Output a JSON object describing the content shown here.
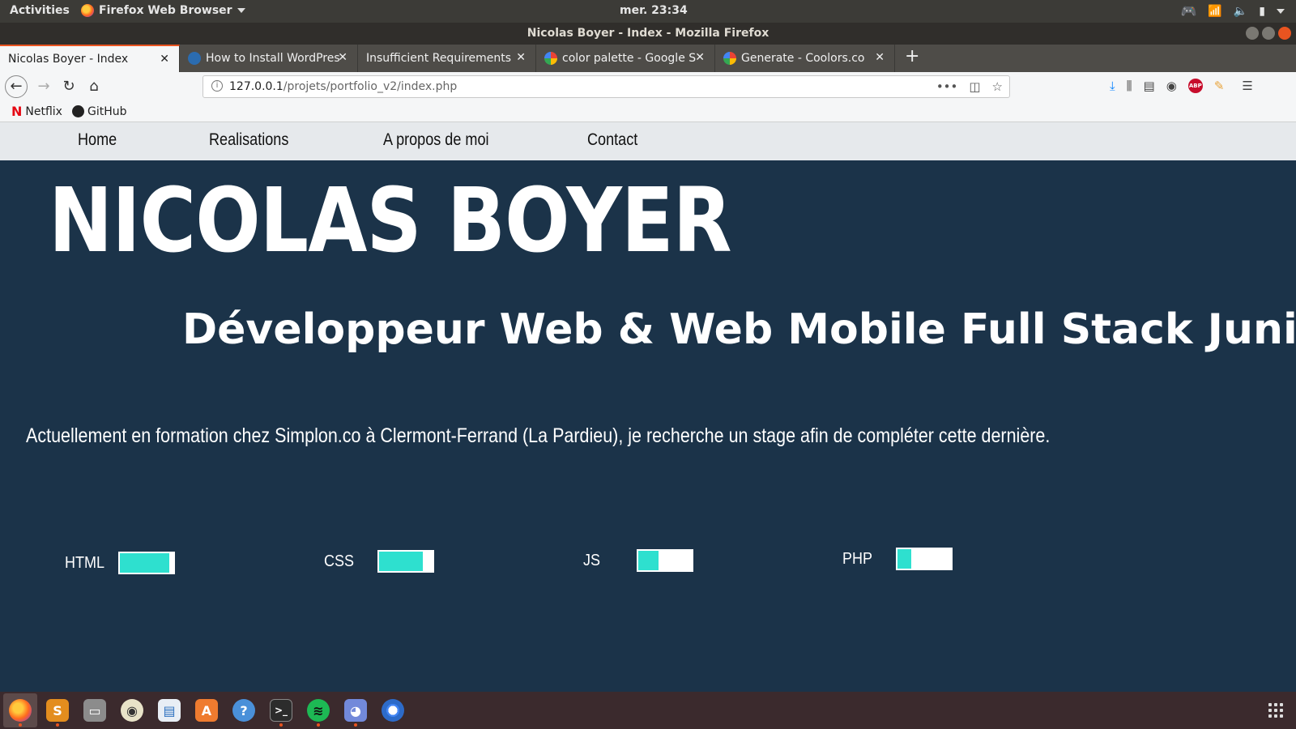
{
  "system_bar": {
    "activities": "Activities",
    "app_menu": "Firefox Web Browser",
    "clock": "mer. 23:34"
  },
  "window": {
    "title": "Nicolas Boyer - Index - Mozilla Firefox"
  },
  "tabs": [
    {
      "label": "Nicolas Boyer - Index",
      "active": true,
      "favicon_color": "#f5f6f7"
    },
    {
      "label": "How to Install WordPress",
      "active": false,
      "favicon_color": "#2b6cb0"
    },
    {
      "label": "Insufficient Requirements",
      "active": false,
      "favicon_color": ""
    },
    {
      "label": "color palette - Google Se",
      "active": false,
      "favicon_color": "#4285f4"
    },
    {
      "label": "Generate - Coolors.co",
      "active": false,
      "favicon_color": "#4285f4"
    }
  ],
  "address_bar": {
    "host": "127.0.0.1",
    "path": "/projets/portfolio_v2/index.php"
  },
  "bookmarks": [
    {
      "label": "Netflix"
    },
    {
      "label": "GitHub"
    }
  ],
  "site": {
    "nav": [
      "Home",
      "Realisations",
      "A propos de moi",
      "Contact"
    ],
    "name": "NICOLAS BOYER",
    "subtitle": "Développeur Web & Web Mobile Full Stack Junior",
    "intro": "Actuellement en formation chez Simplon.co à Clermont-Ferrand (La Pardieu), je recherche un stage afin de compléter cette dernière.",
    "skills": [
      {
        "name": "HTML",
        "level": 0.92
      },
      {
        "name": "CSS",
        "level": 0.82
      },
      {
        "name": "JS",
        "level": 0.38
      },
      {
        "name": "PHP",
        "level": 0.25
      }
    ]
  },
  "colors": {
    "page_bg": "#1b3349",
    "accent": "#2ee0cf",
    "nav_bg": "#e6e9ec"
  },
  "dock": [
    "firefox-icon",
    "sublime-text-icon",
    "files-icon",
    "rhythmbox-icon",
    "libreoffice-writer-icon",
    "software-center-icon",
    "help-icon",
    "terminal-icon",
    "spotify-icon",
    "discord-icon",
    "chromium-icon"
  ]
}
